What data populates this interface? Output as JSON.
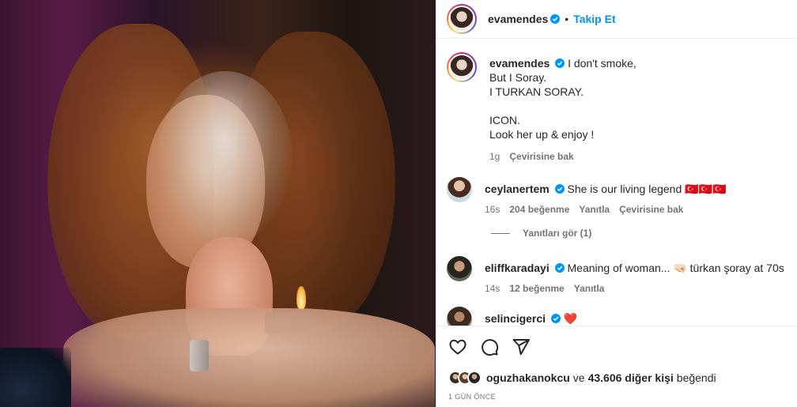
{
  "header": {
    "username": "evamendes",
    "follow_label": "Takip Et",
    "separator": "•"
  },
  "caption": {
    "username": "evamendes",
    "text": "I don't smoke,\nBut I Soray.\nI TURKAN SORAY.\n\nICON.\nLook her up & enjoy !",
    "time": "1g",
    "translate_label": "Çevirisine bak"
  },
  "comments": [
    {
      "username": "ceylanertem",
      "text": "She is our living legend 🇹🇷🇹🇷🇹🇷",
      "time": "16s",
      "likes": "204 beğenme",
      "reply_label": "Yanıtla",
      "translate_label": "Çevirisine bak"
    },
    {
      "username": "eliffkaradayi",
      "text": "Meaning of woman... 🤜🏻 türkan şoray at 70s",
      "time": "14s",
      "likes": "12 beğenme",
      "reply_label": "Yanıtla"
    },
    {
      "username": "selincigerci",
      "text": "❤️"
    }
  ],
  "replies_label": "Yanıtları gör (1)",
  "likes_line": {
    "user": "oguzhakanokcu",
    "connector": "ve",
    "count": "43.606 diğer kişi",
    "suffix": "beğendi"
  },
  "date": "1 GÜN ÖNCE",
  "icons": [
    "heart-icon",
    "comment-icon",
    "share-icon"
  ],
  "colors": {
    "accent": "#0095f6",
    "verified": "#0095f6",
    "heart": "#ff3040"
  }
}
